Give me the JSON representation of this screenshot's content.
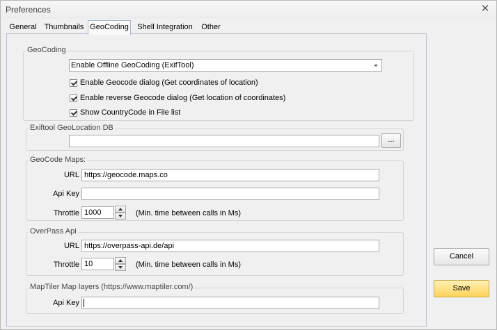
{
  "window": {
    "title": "Preferences"
  },
  "tabs": [
    {
      "label": "General"
    },
    {
      "label": "Thumbnails"
    },
    {
      "label": "GeoCoding"
    },
    {
      "label": "Shell Integration"
    },
    {
      "label": "Other"
    }
  ],
  "geocoding": {
    "group_title": "GeoCoding",
    "mode_select": "Enable Offline GeoCoding (ExifTool)",
    "checkboxes": [
      {
        "label": "Enable Geocode dialog (Get coordinates of location)",
        "checked": true
      },
      {
        "label": "Enable reverse Geocode dialog (Get location of coordinates)",
        "checked": true
      },
      {
        "label": "Show CountryCode in File list",
        "checked": true
      }
    ]
  },
  "exiftool_db": {
    "group_title": "Exiftool GeoLocation DB",
    "path_value": "",
    "browse_label": "..."
  },
  "geocode_maps": {
    "group_title": "GeoCode Maps:",
    "url_label": "URL",
    "url_value": "https://geocode.maps.co",
    "apikey_label": "Api Key",
    "apikey_value": "",
    "throttle_label": "Throttle",
    "throttle_value": "1000",
    "throttle_hint": "(Min. time between calls in Ms)"
  },
  "overpass": {
    "group_title": "OverPass Api",
    "url_label": "URL",
    "url_value": "https://overpass-api.de/api",
    "throttle_label": "Throttle",
    "throttle_value": "10",
    "throttle_hint": "(Min. time between calls in Ms)"
  },
  "maptiler": {
    "group_title": "MapTiler Map layers (https://www.maptiler.com/)",
    "apikey_label": "Api Key",
    "apikey_value": ""
  },
  "buttons": {
    "cancel": "Cancel",
    "save": "Save"
  },
  "colors": {
    "save_accent": "#ffd35a",
    "tab_border": "#aeb9c8"
  }
}
